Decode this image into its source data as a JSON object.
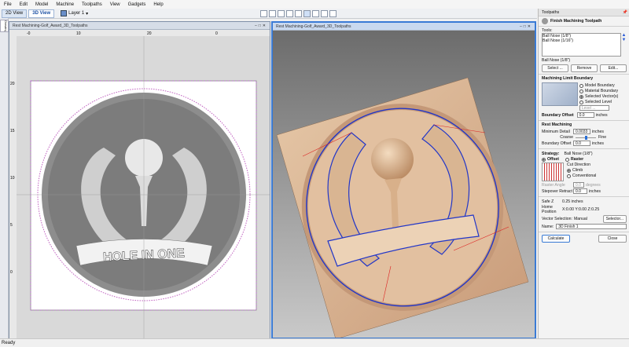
{
  "menu": [
    "File",
    "Edit",
    "Model",
    "Machine",
    "Toolpaths",
    "View",
    "Gadgets",
    "Help"
  ],
  "view_tabs": {
    "tab_2d": "2D View",
    "tab_3d": "3D View"
  },
  "layer": "Layer 1",
  "left_tab": "Drawing",
  "pane2d": {
    "title": "Rest Machining-Golf_Award_3D_Toolpaths",
    "banner": "HOLE IN ONE",
    "ruler_top": [
      "-0",
      "10",
      "20",
      "0"
    ],
    "ruler_left": [
      "20",
      "15",
      "10",
      "5",
      "0"
    ]
  },
  "pane3d": {
    "title": "Rest Machining-Golf_Award_3D_Toolpaths"
  },
  "panel": {
    "title": "Toolpaths",
    "toolpath_name": "Finish Machining Toolpath",
    "tools_label": "Tools:",
    "tools": [
      "Ball Nose (1/8\")",
      "Ball Nose (1/16\")"
    ],
    "selected_tool": "Ball Nose (1/8\")",
    "btn_select": "Select ...",
    "btn_remove": "Remove",
    "btn_edit": "Edit...",
    "limit_title": "Machining Limit Boundary",
    "limit_options": [
      "Model Boundary",
      "Material Boundary",
      "Selected Vector(s)",
      "Selected Level"
    ],
    "level_dd": "Level ...",
    "boundary_offset_label": "Boundary Offset",
    "boundary_offset": "0.0",
    "inches": "inches",
    "rest_title": "Rest Machining",
    "min_detail_label": "Minimum Detail",
    "min_detail": "0.0033",
    "coarse": "Coarse",
    "fine": "Fine",
    "rest_offset_label": "Boundary Offset",
    "rest_offset": "0.0",
    "strategy_label": "Strategy:",
    "strategy_tool": "Ball Nose (1/8\")",
    "offset": "Offset",
    "raster": "Raster",
    "cut_dir": "Cut Direction",
    "climb": "Climb",
    "conventional": "Conventional",
    "raster_angle_label": "Raster Angle",
    "raster_angle": "0.0",
    "degrees": "degrees",
    "stepover_label": "Stepover Retract",
    "stepover": "0.0",
    "safe_z_label": "Safe Z",
    "safe_z": "0.25 inches",
    "home_label": "Home Position",
    "home": "X:0.00 Y:0.00 Z:0.25",
    "vector_sel_label": "Vector Selection:",
    "vector_sel": "Manual",
    "selector_btn": "Selector...",
    "name_label": "Name:",
    "name": "3D Finish 1",
    "calculate": "Calculate",
    "close": "Close"
  },
  "status": "Ready"
}
